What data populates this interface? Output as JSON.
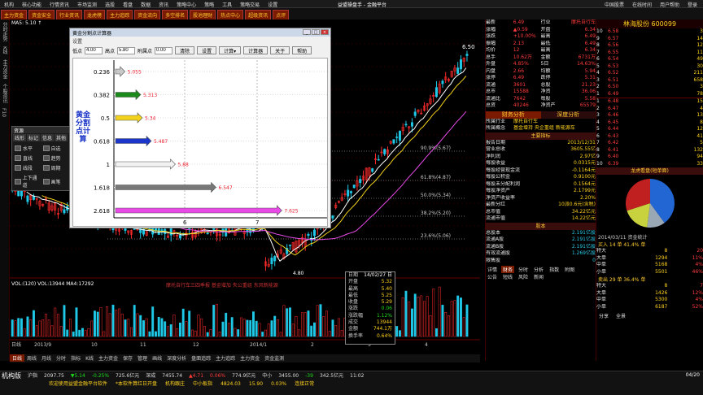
{
  "menubar": {
    "items": [
      "机构",
      "核心功能",
      "行情资讯",
      "市场监测",
      "选股",
      "看盘",
      "数据",
      "资讯",
      "策略中心",
      "策略",
      "工具",
      "策略交易",
      "设置"
    ],
    "center_title": "益盟操盘手 - 金融平台",
    "right": [
      "中国股票",
      "在线时间",
      "用户帮助",
      "登录"
    ]
  },
  "toolbar": {
    "items": [
      "主力资金",
      "资金安全",
      "行业资讯",
      "龙虎榜",
      "主力追踪",
      "资金流向",
      "多空排名",
      "股池理财",
      "热点中心",
      "超级资讯",
      "点评"
    ]
  },
  "sidebar": {
    "items": [
      "分时走势",
      "K线",
      "主力资金",
      "个股资讯",
      "F10"
    ]
  },
  "chart": {
    "stock_label": "MA5: 5.10 ↑",
    "volume_label": "VOL:(120) VOL:13944 MA4:17292",
    "news_marquee": "摩托自行车三四季报 基金增加 失公重组 东风新能源",
    "price_levels": [
      {
        "label": "90.9%(5.67)",
        "price": "5.67"
      },
      {
        "label": "61.8%(4.87)",
        "price": "4.87"
      },
      {
        "label": "50.0%(5.34)",
        "price": "5.34"
      },
      {
        "label": "38.2%(5.20)",
        "price": "5.20"
      },
      {
        "label": "23.6%(5.06)",
        "price": "5.06"
      }
    ],
    "peak_label": "6.50",
    "low_label": "4.80",
    "x_axis": [
      "2013/9",
      "10",
      "11",
      "12",
      "2014/1",
      "2",
      "3",
      "4"
    ],
    "x_axis_prefix": "日线"
  },
  "dialog": {
    "title": "黄金分割点计算器",
    "subtitle": "设置",
    "fields": [
      {
        "label": "低点",
        "value": "4.00"
      },
      {
        "label": "高点",
        "value": "5.80"
      },
      {
        "label": "附属点",
        "value": "0.00"
      }
    ],
    "buttons": [
      "清除",
      "设置",
      "计算▾",
      "计算器",
      "关于",
      "帮助"
    ],
    "vertical_title": "黄金分割点计算",
    "rows": [
      {
        "ratio": "0.236",
        "value": "5.055",
        "color": "#c8c8c8"
      },
      {
        "ratio": "0.382",
        "value": "5.313",
        "color": "#1b8a1b"
      },
      {
        "ratio": "0.5",
        "value": "5.34",
        "color": "#f2d21b"
      },
      {
        "ratio": "0.618",
        "value": "5.487",
        "color": "#1b36c8"
      },
      {
        "ratio": "1",
        "value": "5.88",
        "color": "#f2f2f2"
      },
      {
        "ratio": "1.618",
        "value": "6.547",
        "color": "#777777"
      },
      {
        "ratio": "2.618",
        "value": "7.625",
        "color": "#e84ae8"
      }
    ],
    "axis": [
      "6",
      "7"
    ]
  },
  "drawtool": {
    "title": "资源",
    "tabs": [
      "线形",
      "标记",
      "信息",
      "其他"
    ],
    "items": [
      "水平",
      "自选",
      "直线",
      "趋势",
      "线段",
      "周期",
      "上下通道",
      "画笔"
    ]
  },
  "tooltip": {
    "rows": [
      [
        "日期",
        "14/02/27 日"
      ],
      [
        "开盘",
        "5.32"
      ],
      [
        "最高",
        "5.40"
      ],
      [
        "最低",
        "5.25"
      ],
      [
        "收盘",
        "5.29"
      ],
      [
        "涨跌",
        "0.06"
      ],
      [
        "涨跌幅",
        "1.12%"
      ],
      [
        "成交",
        "13944"
      ],
      [
        "金额",
        "744.1万"
      ],
      [
        "换手率",
        "0.64%"
      ]
    ]
  },
  "bottomtabs": {
    "items": [
      "日线",
      "周线",
      "月线",
      "分时",
      "指标",
      "K线",
      "主力资金",
      "保存",
      "管理",
      "画线",
      "深度分析",
      "盘面追踪",
      "主力追踪",
      "主力资金",
      "资金监测"
    ],
    "active": 0
  },
  "quote": {
    "rows": [
      [
        "最新",
        "6.49",
        "行业",
        "摩托自行车"
      ],
      [
        "涨幅",
        "▲0.59",
        "开盘",
        "6.34"
      ],
      [
        "涨跌",
        "+10.00%",
        "最高",
        "6.49"
      ],
      [
        "振幅",
        "2.13",
        "最低",
        "6.49"
      ],
      [
        "均价",
        "12",
        "最高",
        "6.34"
      ],
      [
        "总手",
        "10.62万",
        "金额",
        "6731万"
      ],
      [
        "外盘",
        "4.85%",
        "5日",
        "14.63%"
      ],
      [
        "内盘",
        "2.66",
        "均额",
        "5.94"
      ],
      [
        "涨停",
        "6.49",
        "跌停",
        "5.31"
      ],
      [
        "流通",
        "3601",
        "总股",
        "21.23"
      ],
      [
        "总市",
        "15588",
        "净资",
        "36.06"
      ],
      [
        "流通比",
        "7642",
        "每股",
        "5.58"
      ],
      [
        "总资",
        "40246",
        "净资产",
        "65579"
      ]
    ],
    "tabs": [
      "财务分析",
      "深度分析"
    ],
    "company": [
      [
        "所属行业",
        "摩托自行车"
      ],
      [
        "所属概念",
        "基金增持 央企重组 新能源车"
      ]
    ],
    "main_title": "主要指标",
    "indicators": [
      [
        "报告日期",
        "2013/12/31"
      ],
      [
        "营业总收",
        "3605.55亿"
      ],
      [
        "净利润",
        "2.97亿"
      ],
      [
        "每股收益",
        "0.0315元"
      ],
      [
        "每股经营现金流",
        "-0.1164元"
      ],
      [
        "每股公积金",
        "0.9100元"
      ],
      [
        "每股未分配利润",
        "0.1564元"
      ],
      [
        "每股净资产",
        "2.1799元"
      ],
      [
        "净资产收益率",
        "2.20%"
      ],
      [
        "最新分红",
        "10派0.6元(含税)"
      ],
      [
        "总市值",
        "34.22亿元"
      ],
      [
        "流通市值",
        "14.22亿元"
      ]
    ],
    "share_title": "股本",
    "shares": [
      [
        "总股本",
        "2.191亿股"
      ],
      [
        "流通A股",
        "2.191亿股"
      ],
      [
        "流通B股",
        "2.191亿股"
      ],
      [
        "有效流通股",
        "1.269亿股"
      ],
      [
        "限售股",
        "0"
      ]
    ],
    "links": [
      "详情",
      "财务",
      "分时",
      "分析",
      "指数",
      "附图"
    ],
    "links2": [
      "公告",
      "短线",
      "风险",
      "新闻"
    ]
  },
  "orderbook": {
    "name": "林海股份",
    "code": "600099",
    "sell": [
      [
        "10",
        "6.58",
        "3"
      ],
      [
        "9",
        "6.57",
        "14"
      ],
      [
        "8",
        "6.56",
        "12"
      ],
      [
        "7",
        "6.55",
        "11"
      ],
      [
        "6",
        "6.54",
        "49"
      ],
      [
        "5",
        "6.53",
        "30"
      ],
      [
        "4",
        "6.52",
        "211"
      ],
      [
        "3",
        "6.51",
        "658"
      ],
      [
        "2",
        "6.50",
        "3"
      ],
      [
        "1",
        "6.49",
        "78"
      ]
    ],
    "buy": [
      [
        "1",
        "6.48",
        "15"
      ],
      [
        "2",
        "6.47",
        "4"
      ],
      [
        "3",
        "6.46",
        "13"
      ],
      [
        "4",
        "6.45",
        "8"
      ],
      [
        "5",
        "6.44",
        "12"
      ],
      [
        "6",
        "6.43",
        "41"
      ],
      [
        "7",
        "6.42",
        "5"
      ],
      [
        "8",
        "6.41",
        "132"
      ],
      [
        "9",
        "6.40",
        "94"
      ],
      [
        "10",
        "6.39",
        "33"
      ]
    ],
    "pie_title": "龙虎看盘(短单面)",
    "pie_date": "2014/03/11 资金统计",
    "pie_colors": [
      "#2266d4",
      "#9aa7b4",
      "#c8d23e",
      "#c02020"
    ],
    "pie_values": [
      40,
      12,
      18,
      30
    ],
    "fund_header": "买入 14 单  41.4% 单",
    "fund": [
      [
        "特大",
        "8",
        "20"
      ],
      [
        "大单",
        "1294",
        "11%"
      ],
      [
        "中单",
        "5168",
        "4%"
      ],
      [
        "小单",
        "5501",
        "46%"
      ]
    ],
    "fund2_header": "卖出 29 单  36.4% 单",
    "fund2": [
      [
        "特大",
        "8",
        "7"
      ],
      [
        "大单",
        "1426",
        "12%"
      ],
      [
        "中单",
        "5300",
        "4%"
      ],
      [
        "小单",
        "6187",
        "52%"
      ]
    ],
    "tabs": [
      "分享",
      "全景"
    ]
  },
  "statusbar": {
    "row1": [
      "机构版",
      "沪指",
      "2097.75",
      "▼5.14",
      "-0.25%",
      "725.6亿元",
      "深成",
      "7455.74",
      "▲4.71",
      "0.06%",
      "774.9亿元",
      "中小",
      "3455.00",
      "-39",
      "342.5亿元",
      "11:02"
    ],
    "row2": [
      "欢迎使用益盟金融平台软件",
      "*本软件算红日开盘",
      "机构跟庄",
      "中小板指",
      "4824.03",
      "15.90",
      "0.03%",
      "连接正常"
    ],
    "date": "04/20"
  }
}
